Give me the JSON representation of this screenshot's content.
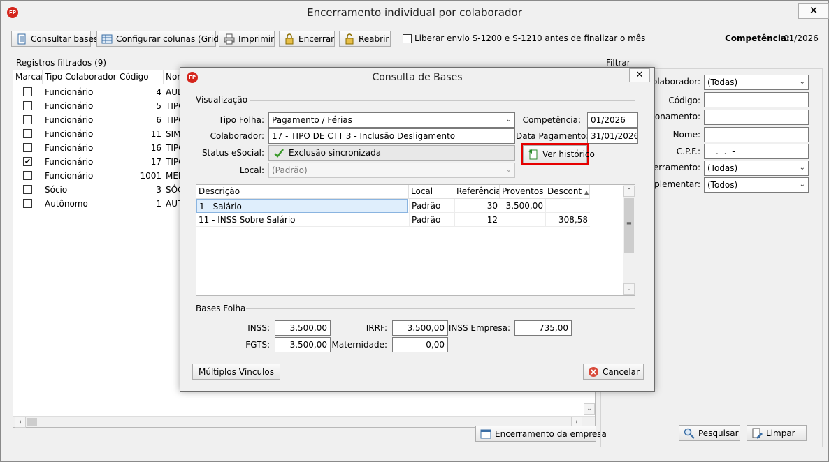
{
  "main": {
    "title": "Encerramento individual por colaborador",
    "close_label": "✕",
    "toolbar": {
      "consultar_bases": "Consultar bases",
      "configurar_colunas": "Configurar colunas (Grid)",
      "imprimir": "Imprimir",
      "encerrar": "Encerrar",
      "reabrir": "Reabrir",
      "liberar_envio": "Liberar envio S-1200 e S-1210 antes de finalizar o mês",
      "competencia_label": "Competência:",
      "competencia_value": "01/2026"
    },
    "registros": {
      "title": "Registros filtrados (9)",
      "columns": [
        "Marcar",
        "Tipo Colaborador",
        "Código",
        "Nom"
      ],
      "rows": [
        {
          "checked": false,
          "tipo": "Funcionário",
          "codigo": "4",
          "nome": "AUL"
        },
        {
          "checked": false,
          "tipo": "Funcionário",
          "codigo": "5",
          "nome": "TIPO"
        },
        {
          "checked": false,
          "tipo": "Funcionário",
          "codigo": "6",
          "nome": "TIPO"
        },
        {
          "checked": false,
          "tipo": "Funcionário",
          "codigo": "11",
          "nome": "SIM"
        },
        {
          "checked": false,
          "tipo": "Funcionário",
          "codigo": "16",
          "nome": "TIPO"
        },
        {
          "checked": true,
          "tipo": "Funcionário",
          "codigo": "17",
          "nome": "TIPO"
        },
        {
          "checked": false,
          "tipo": "Funcionário",
          "codigo": "1001",
          "nome": "MEN"
        },
        {
          "checked": false,
          "tipo": "Sócio",
          "codigo": "3",
          "nome": "SÓC"
        },
        {
          "checked": false,
          "tipo": "Autônomo",
          "codigo": "1",
          "nome": "AUT"
        }
      ]
    },
    "filtrar": {
      "title": "Filtrar",
      "colaborador_label": "Colaborador:",
      "colaborador_value": "(Todas)",
      "codigo_label": "Código:",
      "relacionamento_label": "cionamento:",
      "nome_label": "Nome:",
      "cpf_label": "C.P.F.:",
      "cpf_mask": ". . -",
      "encerramento_label": "ncerramento:",
      "encerramento_value": "(Todas)",
      "complementar_label": "mplementar:",
      "complementar_value": "(Todos)",
      "pesquisar": "Pesquisar",
      "limpar": "Limpar"
    },
    "encerramento_empresa": "Encerramento da empresa"
  },
  "dialog": {
    "title": "Consulta de Bases",
    "close_label": "✕",
    "visualizacao_label": "Visualização",
    "tipo_folha_label": "Tipo Folha:",
    "tipo_folha_value": "Pagamento / Férias",
    "colaborador_label": "Colaborador:",
    "colaborador_value": "17 - TIPO DE CTT 3 - Inclusão Desligamento",
    "status_label": "Status eSocial:",
    "status_value": "Exclusão sincronizada",
    "local_label": "Local:",
    "local_value": "(Padrão)",
    "competencia_label": "Competência:",
    "competencia_value": "01/2026",
    "data_pagamento_label": "Data Pagamento:",
    "data_pagamento_value": "31/01/2026",
    "ver_historico": "Ver histórico",
    "highlight_color": "#e60000",
    "grid": {
      "columns": [
        "Descrição",
        "Local",
        "Referência",
        "Proventos",
        "Descont"
      ],
      "rows": [
        {
          "descricao": "1 - Salário",
          "local": "Padrão",
          "referencia": "30",
          "proventos": "3.500,00",
          "descontos": ""
        },
        {
          "descricao": "11 - INSS Sobre Salário",
          "local": "Padrão",
          "referencia": "12",
          "proventos": "",
          "descontos": "308,58"
        }
      ]
    },
    "bases_folha_label": "Bases Folha",
    "inss_label": "INSS:",
    "inss_value": "3.500,00",
    "fgts_label": "FGTS:",
    "fgts_value": "3.500,00",
    "irrf_label": "IRRF:",
    "irrf_value": "3.500,00",
    "maternidade_label": "Maternidade:",
    "maternidade_value": "0,00",
    "inss_empresa_label": "INSS Empresa:",
    "inss_empresa_value": "735,00",
    "multiplos_vinculos": "Múltiplos Vínculos",
    "cancelar": "Cancelar"
  },
  "icons": {
    "app": "fp-logo-icon",
    "status": "check-icon"
  }
}
